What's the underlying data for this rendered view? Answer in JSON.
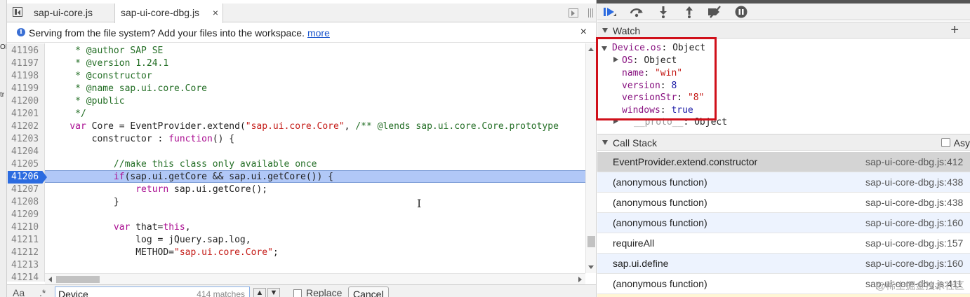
{
  "tabs": {
    "inactive": "sap-ui-core.js",
    "active": "sap-ui-core-dbg.js",
    "close_glyph": "×"
  },
  "outer_strip": {
    "top": "OD",
    "mid": "tr"
  },
  "infobar": {
    "text": "Serving from the file system? Add your files into the workspace.",
    "link": "more",
    "close_glyph": "×",
    "icon": "info-icon"
  },
  "editor": {
    "current_line_index": 10,
    "lines": [
      {
        "num": "41196",
        "segments": [
          {
            "t": "     * @author SAP SE",
            "c": "c-cm"
          }
        ]
      },
      {
        "num": "41197",
        "segments": [
          {
            "t": "     * @version 1.24.1",
            "c": "c-cm"
          }
        ]
      },
      {
        "num": "41198",
        "segments": [
          {
            "t": "     * @constructor",
            "c": "c-cm"
          }
        ]
      },
      {
        "num": "41199",
        "segments": [
          {
            "t": "     * @name sap.ui.core.Core",
            "c": "c-cm"
          }
        ]
      },
      {
        "num": "41200",
        "segments": [
          {
            "t": "     * @public",
            "c": "c-cm"
          }
        ]
      },
      {
        "num": "41201",
        "segments": [
          {
            "t": "     */",
            "c": "c-cm"
          }
        ]
      },
      {
        "num": "41202",
        "segments": [
          {
            "t": "    ",
            "c": "c-plain"
          },
          {
            "t": "var",
            "c": "c-kw"
          },
          {
            "t": " Core = EventProvider.extend(",
            "c": "c-plain"
          },
          {
            "t": "\"sap.ui.core.Core\"",
            "c": "c-str"
          },
          {
            "t": ", ",
            "c": "c-plain"
          },
          {
            "t": "/** @lends sap.ui.core.Core.prototype",
            "c": "c-cm"
          }
        ]
      },
      {
        "num": "41203",
        "segments": [
          {
            "t": "        constructor : ",
            "c": "c-plain"
          },
          {
            "t": "function",
            "c": "c-kw"
          },
          {
            "t": "() {",
            "c": "c-plain"
          }
        ]
      },
      {
        "num": "41204",
        "segments": [
          {
            "t": "",
            "c": "c-plain"
          }
        ]
      },
      {
        "num": "41205",
        "segments": [
          {
            "t": "            //make this class only available once",
            "c": "c-cm"
          }
        ]
      },
      {
        "num": "41206",
        "segments": [
          {
            "t": "            ",
            "c": "c-plain"
          },
          {
            "t": "if",
            "c": "c-kw"
          },
          {
            "t": "(sap.ui.getCore && sap.ui.getCore()) {",
            "c": "c-plain"
          }
        ]
      },
      {
        "num": "41207",
        "segments": [
          {
            "t": "                ",
            "c": "c-plain"
          },
          {
            "t": "return",
            "c": "c-kw"
          },
          {
            "t": " sap.ui.getCore();",
            "c": "c-plain"
          }
        ]
      },
      {
        "num": "41208",
        "segments": [
          {
            "t": "            }",
            "c": "c-plain"
          }
        ]
      },
      {
        "num": "41209",
        "segments": [
          {
            "t": "",
            "c": "c-plain"
          }
        ]
      },
      {
        "num": "41210",
        "segments": [
          {
            "t": "            ",
            "c": "c-plain"
          },
          {
            "t": "var",
            "c": "c-kw"
          },
          {
            "t": " that=",
            "c": "c-plain"
          },
          {
            "t": "this",
            "c": "c-kw"
          },
          {
            "t": ",",
            "c": "c-plain"
          }
        ]
      },
      {
        "num": "41211",
        "segments": [
          {
            "t": "                log = jQuery.sap.log,",
            "c": "c-plain"
          }
        ]
      },
      {
        "num": "41212",
        "segments": [
          {
            "t": "                METHOD=",
            "c": "c-plain"
          },
          {
            "t": "\"sap.ui.core.Core\"",
            "c": "c-str"
          },
          {
            "t": ";",
            "c": "c-plain"
          }
        ]
      },
      {
        "num": "41213",
        "segments": [
          {
            "t": "",
            "c": "c-plain"
          }
        ]
      },
      {
        "num": "41214",
        "segments": [
          {
            "t": "",
            "c": "c-plain"
          }
        ]
      }
    ]
  },
  "search": {
    "aa": "Aa",
    "dot": ".*",
    "value": "Device",
    "matches": "414 matches",
    "up": "▲",
    "down": "▼",
    "replace_label": "Replace",
    "cancel_label": "Cancel"
  },
  "debugger_toolbar": {
    "buttons": [
      "resume-icon",
      "step-over-icon",
      "step-into-icon",
      "step-out-icon",
      "deactivate-breakpoints-icon",
      "pause-on-exceptions-icon"
    ]
  },
  "watch": {
    "title": "Watch",
    "add_glyph": "+",
    "root_name": "Device.os",
    "root_value": "Object",
    "os_name": "OS",
    "os_value": "Object",
    "props": [
      {
        "key": "name",
        "value": "\"win\"",
        "kind": "string"
      },
      {
        "key": "version",
        "value": "8",
        "kind": "number"
      },
      {
        "key": "versionStr",
        "value": "\"8\"",
        "kind": "string"
      },
      {
        "key": "windows",
        "value": "true",
        "kind": "bool"
      }
    ],
    "proto_name": "__proto__",
    "proto_value": "Object"
  },
  "callstack": {
    "title": "Call Stack",
    "async_label": "Asy",
    "frames": [
      {
        "fn": "EventProvider.extend.constructor",
        "loc": "sap-ui-core-dbg.js:412",
        "state": "selected"
      },
      {
        "fn": "(anonymous function)",
        "loc": "sap-ui-core-dbg.js:438",
        "state": "alt"
      },
      {
        "fn": "(anonymous function)",
        "loc": "sap-ui-core-dbg.js:438",
        "state": ""
      },
      {
        "fn": "(anonymous function)",
        "loc": "sap-ui-core-dbg.js:160",
        "state": "alt"
      },
      {
        "fn": "requireAll",
        "loc": "sap-ui-core-dbg.js:157",
        "state": ""
      },
      {
        "fn": "sap.ui.define",
        "loc": "sap-ui-core-dbg.js:160",
        "state": "alt"
      },
      {
        "fn": "(anonymous function)",
        "loc": "sap-ui-core-dbg.js:411",
        "state": ""
      }
    ]
  },
  "watermark": "@稀土掘金技术社区",
  "colors": {
    "highlight_row": "#b1c8f7",
    "breakpoint": "#2b6be0",
    "annotation_box": "#d0101a",
    "accent_link": "#1a55cc"
  }
}
